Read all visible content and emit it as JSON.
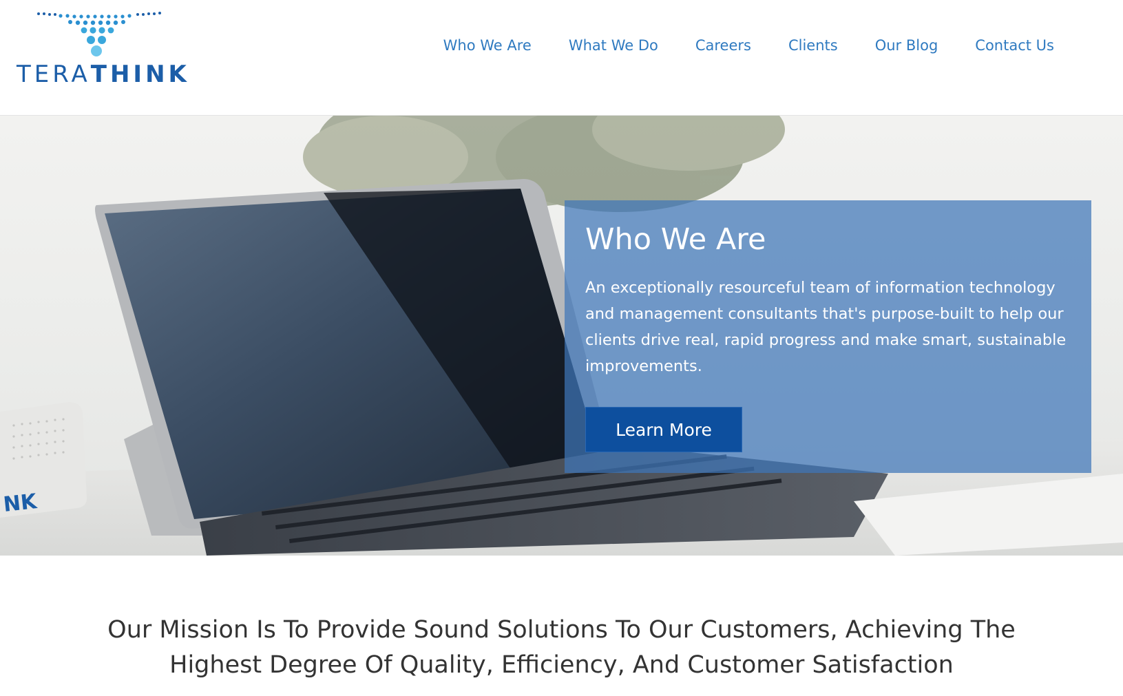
{
  "brand": {
    "name_light": "TERA",
    "name_bold": "THINK",
    "primary_color": "#1c5ea8",
    "dot_colors": [
      "#1c5ea8",
      "#3aa7dc",
      "#6cc6ec"
    ]
  },
  "nav": {
    "items": [
      "Who We Are",
      "What We Do",
      "Careers",
      "Clients",
      "Our Blog",
      "Contact Us"
    ],
    "link_color": "#2f7ac0"
  },
  "hero": {
    "image": "laptop-on-desk-photo",
    "title": "Who We Are",
    "body": "An exceptionally resourceful team of information technology and management consultants that's purpose-built to help our clients drive real, rapid progress and make smart, sustainable improvements.",
    "cta_label": "Learn More",
    "box_logo_text": "NK"
  },
  "mission": {
    "line1": "Our Mission Is To Provide Sound Solutions To Our Customers, Achieving The",
    "line2": "Highest Degree Of Quality, Efficiency, And Customer Satisfaction"
  }
}
